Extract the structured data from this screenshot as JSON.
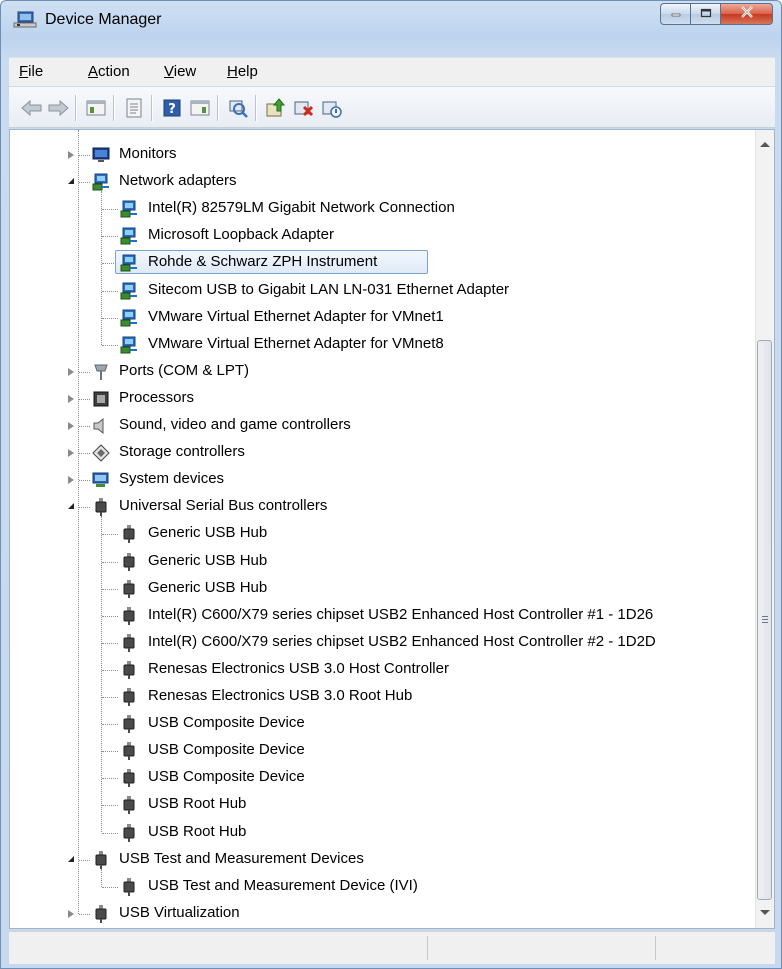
{
  "window": {
    "title": "Device Manager",
    "accent": "#c5d8ef"
  },
  "menubar": {
    "items": [
      {
        "label_u": "F",
        "label_rest": "ile"
      },
      {
        "label_u": "A",
        "label_rest": "ction"
      },
      {
        "label_u": "V",
        "label_rest": "iew"
      },
      {
        "label_u": "H",
        "label_rest": "elp"
      }
    ]
  },
  "toolbar": {
    "buttons": [
      "back-icon",
      "forward-icon",
      "show-hide-console-tree-icon",
      "properties-icon",
      "help-icon",
      "show-action-pane-icon",
      "scan-hardware-icon",
      "update-driver-icon",
      "uninstall-icon",
      "disable-device-icon"
    ]
  },
  "tree": {
    "selected": "Rohde & Schwarz ZPH Instrument",
    "items": [
      {
        "label": "Monitors",
        "level": 0,
        "state": "collapsed",
        "icon": "monitor-icon"
      },
      {
        "label": "Network adapters",
        "level": 0,
        "state": "expanded",
        "icon": "network-adapter-icon"
      },
      {
        "label": "Intel(R) 82579LM Gigabit Network Connection",
        "level": 1,
        "icon": "network-adapter-icon"
      },
      {
        "label": "Microsoft Loopback Adapter",
        "level": 1,
        "icon": "network-adapter-icon"
      },
      {
        "label": "Rohde & Schwarz ZPH Instrument",
        "level": 1,
        "icon": "network-adapter-icon",
        "selected": true
      },
      {
        "label": "Sitecom USB to Gigabit LAN LN-031 Ethernet Adapter",
        "level": 1,
        "icon": "network-adapter-icon"
      },
      {
        "label": "VMware Virtual Ethernet Adapter for VMnet1",
        "level": 1,
        "icon": "network-adapter-icon"
      },
      {
        "label": "VMware Virtual Ethernet Adapter for VMnet8",
        "level": 1,
        "icon": "network-adapter-icon"
      },
      {
        "label": "Ports (COM & LPT)",
        "level": 0,
        "state": "collapsed",
        "icon": "port-icon"
      },
      {
        "label": "Processors",
        "level": 0,
        "state": "collapsed",
        "icon": "processor-icon"
      },
      {
        "label": "Sound, video and game controllers",
        "level": 0,
        "state": "collapsed",
        "icon": "speaker-icon"
      },
      {
        "label": "Storage controllers",
        "level": 0,
        "state": "collapsed",
        "icon": "storage-icon"
      },
      {
        "label": "System devices",
        "level": 0,
        "state": "collapsed",
        "icon": "system-device-icon"
      },
      {
        "label": "Universal Serial Bus controllers",
        "level": 0,
        "state": "expanded",
        "icon": "usb-plug-icon"
      },
      {
        "label": "Generic USB Hub",
        "level": 1,
        "icon": "usb-plug-icon"
      },
      {
        "label": "Generic USB Hub",
        "level": 1,
        "icon": "usb-plug-icon"
      },
      {
        "label": "Generic USB Hub",
        "level": 1,
        "icon": "usb-plug-icon"
      },
      {
        "label": "Intel(R) C600/X79 series chipset USB2 Enhanced Host Controller #1 - 1D26",
        "level": 1,
        "icon": "usb-plug-icon"
      },
      {
        "label": "Intel(R) C600/X79 series chipset USB2 Enhanced Host Controller #2 - 1D2D",
        "level": 1,
        "icon": "usb-plug-icon"
      },
      {
        "label": "Renesas Electronics USB 3.0 Host Controller",
        "level": 1,
        "icon": "usb-plug-icon"
      },
      {
        "label": "Renesas Electronics USB 3.0 Root Hub",
        "level": 1,
        "icon": "usb-plug-icon"
      },
      {
        "label": "USB Composite Device",
        "level": 1,
        "icon": "usb-plug-icon"
      },
      {
        "label": "USB Composite Device",
        "level": 1,
        "icon": "usb-plug-icon"
      },
      {
        "label": "USB Composite Device",
        "level": 1,
        "icon": "usb-plug-icon"
      },
      {
        "label": "USB Root Hub",
        "level": 1,
        "icon": "usb-plug-icon"
      },
      {
        "label": "USB Root Hub",
        "level": 1,
        "icon": "usb-plug-icon"
      },
      {
        "label": "USB Test and Measurement Devices",
        "level": 0,
        "state": "expanded",
        "icon": "usb-plug-icon"
      },
      {
        "label": "USB Test and Measurement Device (IVI)",
        "level": 1,
        "icon": "usb-plug-icon"
      },
      {
        "label": "USB Virtualization",
        "level": 0,
        "state": "collapsed",
        "icon": "usb-plug-icon"
      }
    ]
  },
  "statusbar": {
    "segments": [
      "",
      "",
      ""
    ]
  }
}
